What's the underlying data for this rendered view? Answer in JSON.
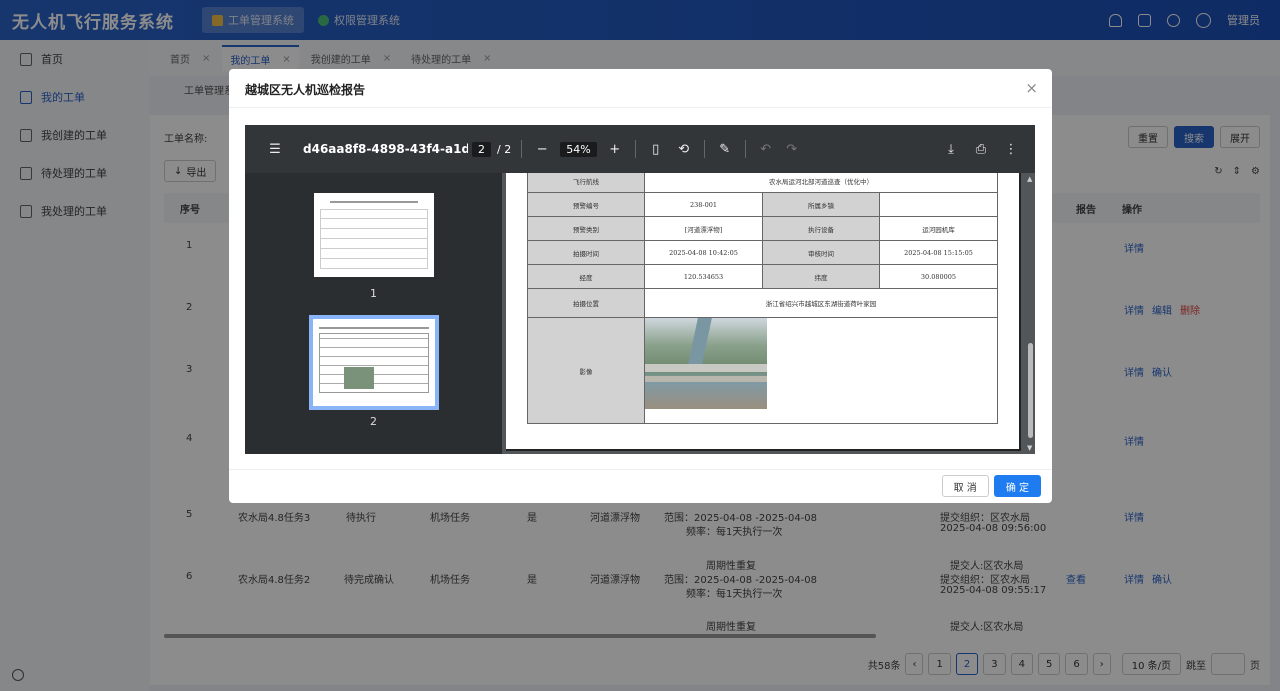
{
  "app": {
    "title": "无人机飞行服务系统"
  },
  "topnav": [
    {
      "label": "工单管理系统"
    },
    {
      "label": "权限管理系统"
    }
  ],
  "user": {
    "name": "管理员"
  },
  "sidebar": [
    {
      "label": "首页"
    },
    {
      "label": "我的工单"
    },
    {
      "label": "我创建的工单"
    },
    {
      "label": "待处理的工单"
    },
    {
      "label": "我处理的工单"
    }
  ],
  "tabs": [
    {
      "label": "首页"
    },
    {
      "label": "我的工单"
    },
    {
      "label": "我创建的工单"
    },
    {
      "label": "待处理的工单"
    }
  ],
  "breadcrumb": "工单管理系",
  "filter": {
    "name_label": "工单名称:",
    "reset": "重置",
    "search": "搜索",
    "expand": "展开"
  },
  "toolbar": {
    "export": "导出"
  },
  "table": {
    "col_index": "序号",
    "col_report": "报告",
    "col_ops": "操作",
    "rows": [
      {
        "i": "1",
        "ops": [
          "详情"
        ]
      },
      {
        "i": "2",
        "ops": [
          "详情",
          "编辑",
          "删除"
        ]
      },
      {
        "i": "3",
        "ops": [
          "详情",
          "确认"
        ]
      },
      {
        "i": "4",
        "ops": [
          "详情"
        ]
      },
      {
        "i": "5",
        "name": "农水局4.8任务3",
        "status": "待执行",
        "type": "机场任务",
        "flag": "是",
        "target": "河道漂浮物",
        "range": "范围：2025-04-08 -2025-04-08",
        "freq": "频率：每1天执行一次",
        "submit": "提交组织：区农水局",
        "time": "2025-04-08 09:56:00",
        "ops": [
          "详情"
        ]
      },
      {
        "i": "6",
        "name": "农水局4.8任务2",
        "status": "待完成确认",
        "type": "机场任务",
        "flag": "是",
        "target": "河道漂浮物",
        "cycle": "周期性重复",
        "range": "范围：2025-04-08 -2025-04-08",
        "freq": "频率：每1天执行一次",
        "submitter": "提交人:区农水局",
        "submit": "提交组织：区农水局",
        "time": "2025-04-08 09:55:17",
        "report": "查看",
        "ops": [
          "详情",
          "确认"
        ]
      }
    ],
    "next_cycle": "周期性重复",
    "next_submitter": "提交人:区农水局"
  },
  "pagination": {
    "total": "共58条",
    "pages": [
      "1",
      "2",
      "3",
      "4",
      "5",
      "6"
    ],
    "current": "2",
    "size": "10 条/页",
    "goto": "跳至",
    "unit": "页"
  },
  "modal": {
    "title": "越城区无人机巡检报告",
    "cancel": "取 消",
    "ok": "确 定"
  },
  "viewer": {
    "file": "d46aa8f8-4898-43f4-a1de...",
    "page": "2",
    "pages": "/ 2",
    "zoom": "54%",
    "thumb1": "1",
    "thumb2": "2"
  },
  "report": {
    "route_label": "飞行航线",
    "route": "农水局运河北部河道巡查（优化中）",
    "alarm_no_label": "预警编号",
    "alarm_no": "238-001",
    "town_label": "所属乡镇",
    "town": "",
    "alarm_type_label": "预警类别",
    "alarm_type": "[河道漂浮物]",
    "device_label": "执行设备",
    "device": "运河园机库",
    "capture_time_label": "拍摄时间",
    "capture_time": "2025-04-08 10:42:05",
    "review_time_label": "审核时间",
    "review_time": "2025-04-08 15:15:05",
    "lng_label": "经度",
    "lng": "120.534653",
    "lat_label": "纬度",
    "lat": "30.080005",
    "location_label": "拍摄位置",
    "location": "浙江省绍兴市越城区东湖街道荷叶家园",
    "image_label": "影像"
  }
}
